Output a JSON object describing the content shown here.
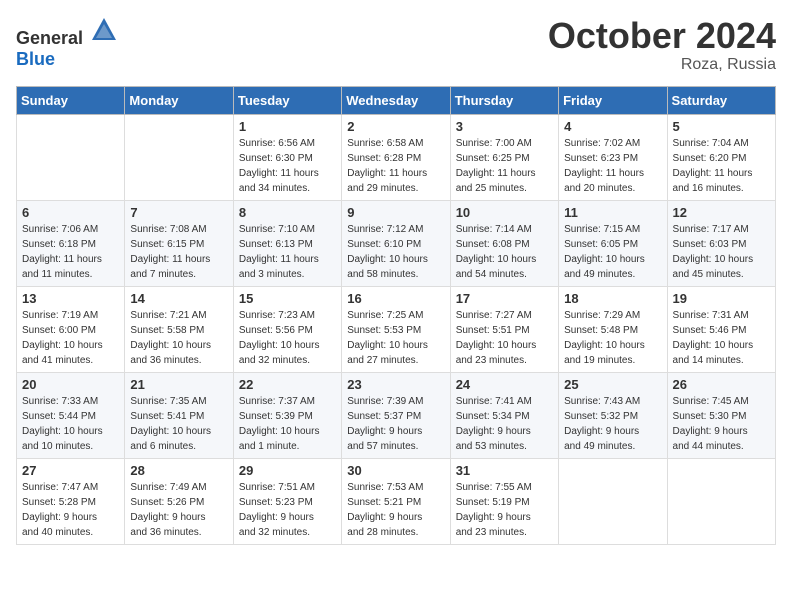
{
  "logo": {
    "general": "General",
    "blue": "Blue"
  },
  "title": "October 2024",
  "location": "Roza, Russia",
  "days_of_week": [
    "Sunday",
    "Monday",
    "Tuesday",
    "Wednesday",
    "Thursday",
    "Friday",
    "Saturday"
  ],
  "weeks": [
    [
      {
        "day": "",
        "info": ""
      },
      {
        "day": "",
        "info": ""
      },
      {
        "day": "1",
        "info": "Sunrise: 6:56 AM\nSunset: 6:30 PM\nDaylight: 11 hours\nand 34 minutes."
      },
      {
        "day": "2",
        "info": "Sunrise: 6:58 AM\nSunset: 6:28 PM\nDaylight: 11 hours\nand 29 minutes."
      },
      {
        "day": "3",
        "info": "Sunrise: 7:00 AM\nSunset: 6:25 PM\nDaylight: 11 hours\nand 25 minutes."
      },
      {
        "day": "4",
        "info": "Sunrise: 7:02 AM\nSunset: 6:23 PM\nDaylight: 11 hours\nand 20 minutes."
      },
      {
        "day": "5",
        "info": "Sunrise: 7:04 AM\nSunset: 6:20 PM\nDaylight: 11 hours\nand 16 minutes."
      }
    ],
    [
      {
        "day": "6",
        "info": "Sunrise: 7:06 AM\nSunset: 6:18 PM\nDaylight: 11 hours\nand 11 minutes."
      },
      {
        "day": "7",
        "info": "Sunrise: 7:08 AM\nSunset: 6:15 PM\nDaylight: 11 hours\nand 7 minutes."
      },
      {
        "day": "8",
        "info": "Sunrise: 7:10 AM\nSunset: 6:13 PM\nDaylight: 11 hours\nand 3 minutes."
      },
      {
        "day": "9",
        "info": "Sunrise: 7:12 AM\nSunset: 6:10 PM\nDaylight: 10 hours\nand 58 minutes."
      },
      {
        "day": "10",
        "info": "Sunrise: 7:14 AM\nSunset: 6:08 PM\nDaylight: 10 hours\nand 54 minutes."
      },
      {
        "day": "11",
        "info": "Sunrise: 7:15 AM\nSunset: 6:05 PM\nDaylight: 10 hours\nand 49 minutes."
      },
      {
        "day": "12",
        "info": "Sunrise: 7:17 AM\nSunset: 6:03 PM\nDaylight: 10 hours\nand 45 minutes."
      }
    ],
    [
      {
        "day": "13",
        "info": "Sunrise: 7:19 AM\nSunset: 6:00 PM\nDaylight: 10 hours\nand 41 minutes."
      },
      {
        "day": "14",
        "info": "Sunrise: 7:21 AM\nSunset: 5:58 PM\nDaylight: 10 hours\nand 36 minutes."
      },
      {
        "day": "15",
        "info": "Sunrise: 7:23 AM\nSunset: 5:56 PM\nDaylight: 10 hours\nand 32 minutes."
      },
      {
        "day": "16",
        "info": "Sunrise: 7:25 AM\nSunset: 5:53 PM\nDaylight: 10 hours\nand 27 minutes."
      },
      {
        "day": "17",
        "info": "Sunrise: 7:27 AM\nSunset: 5:51 PM\nDaylight: 10 hours\nand 23 minutes."
      },
      {
        "day": "18",
        "info": "Sunrise: 7:29 AM\nSunset: 5:48 PM\nDaylight: 10 hours\nand 19 minutes."
      },
      {
        "day": "19",
        "info": "Sunrise: 7:31 AM\nSunset: 5:46 PM\nDaylight: 10 hours\nand 14 minutes."
      }
    ],
    [
      {
        "day": "20",
        "info": "Sunrise: 7:33 AM\nSunset: 5:44 PM\nDaylight: 10 hours\nand 10 minutes."
      },
      {
        "day": "21",
        "info": "Sunrise: 7:35 AM\nSunset: 5:41 PM\nDaylight: 10 hours\nand 6 minutes."
      },
      {
        "day": "22",
        "info": "Sunrise: 7:37 AM\nSunset: 5:39 PM\nDaylight: 10 hours\nand 1 minute."
      },
      {
        "day": "23",
        "info": "Sunrise: 7:39 AM\nSunset: 5:37 PM\nDaylight: 9 hours\nand 57 minutes."
      },
      {
        "day": "24",
        "info": "Sunrise: 7:41 AM\nSunset: 5:34 PM\nDaylight: 9 hours\nand 53 minutes."
      },
      {
        "day": "25",
        "info": "Sunrise: 7:43 AM\nSunset: 5:32 PM\nDaylight: 9 hours\nand 49 minutes."
      },
      {
        "day": "26",
        "info": "Sunrise: 7:45 AM\nSunset: 5:30 PM\nDaylight: 9 hours\nand 44 minutes."
      }
    ],
    [
      {
        "day": "27",
        "info": "Sunrise: 7:47 AM\nSunset: 5:28 PM\nDaylight: 9 hours\nand 40 minutes."
      },
      {
        "day": "28",
        "info": "Sunrise: 7:49 AM\nSunset: 5:26 PM\nDaylight: 9 hours\nand 36 minutes."
      },
      {
        "day": "29",
        "info": "Sunrise: 7:51 AM\nSunset: 5:23 PM\nDaylight: 9 hours\nand 32 minutes."
      },
      {
        "day": "30",
        "info": "Sunrise: 7:53 AM\nSunset: 5:21 PM\nDaylight: 9 hours\nand 28 minutes."
      },
      {
        "day": "31",
        "info": "Sunrise: 7:55 AM\nSunset: 5:19 PM\nDaylight: 9 hours\nand 23 minutes."
      },
      {
        "day": "",
        "info": ""
      },
      {
        "day": "",
        "info": ""
      }
    ]
  ]
}
